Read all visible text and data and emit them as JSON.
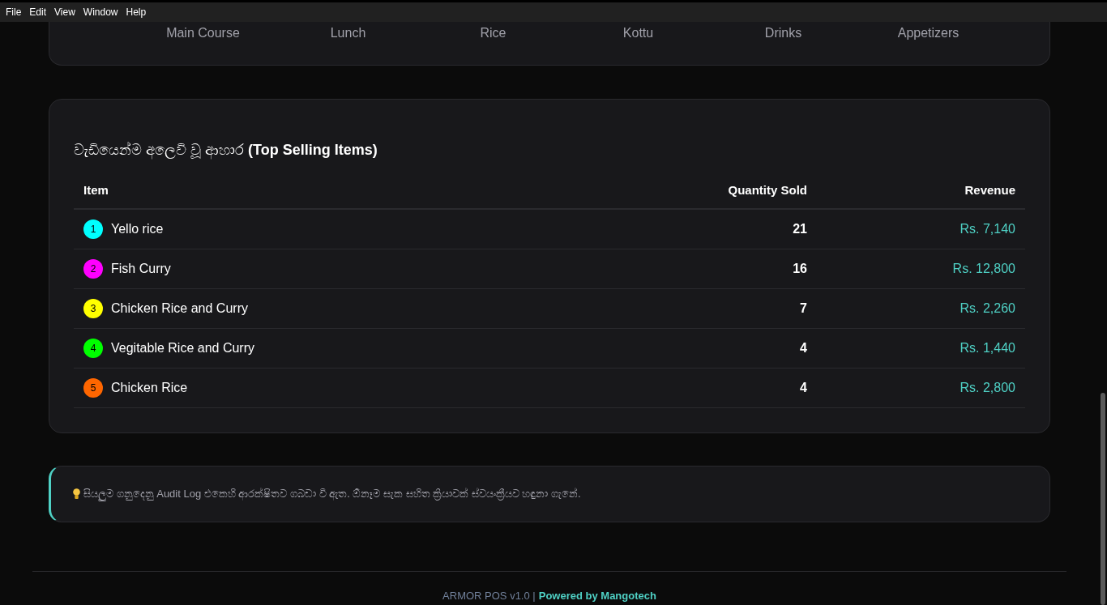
{
  "menu": [
    "File",
    "Edit",
    "View",
    "Window",
    "Help"
  ],
  "categories": [
    "Main Course",
    "Lunch",
    "Rice",
    "Kottu",
    "Drinks",
    "Appetizers"
  ],
  "top_selling": {
    "title": "වැඩියෙන්ම අලෙවි වූ ආහාර **(Top Selling Items)**",
    "columns": [
      "Item",
      "Quantity Sold",
      "Revenue"
    ],
    "rows": [
      {
        "rank": "1",
        "color": "#00ffff",
        "item": "Yello rice",
        "quantity": "21",
        "revenue": "Rs. 7,140"
      },
      {
        "rank": "2",
        "color": "#ff00ff",
        "item": "Fish Curry",
        "quantity": "16",
        "revenue": "Rs. 12,800"
      },
      {
        "rank": "3",
        "color": "#ffff00",
        "item": "Chicken Rice and Curry",
        "quantity": "7",
        "revenue": "Rs. 2,260"
      },
      {
        "rank": "4",
        "color": "#00ff00",
        "item": "Vegitable Rice and Curry",
        "quantity": "4",
        "revenue": "Rs. 1,440"
      },
      {
        "rank": "5",
        "color": "#ff6600",
        "item": "Chicken Rice",
        "quantity": "4",
        "revenue": "Rs. 2,800"
      }
    ]
  },
  "notice": "සියලුම ගනුදෙනු Audit Log එකෙහි ආරක්ෂිතව ගබඩා වී ඇත. ඕනෑම සැක සහිත ක්‍රියාවක් ස්වයංක්‍රීයව හඳුනා ගැනේ.",
  "footer": {
    "version": "ARMOR POS v1.0 |",
    "powered": "Powered by Mangotech"
  }
}
